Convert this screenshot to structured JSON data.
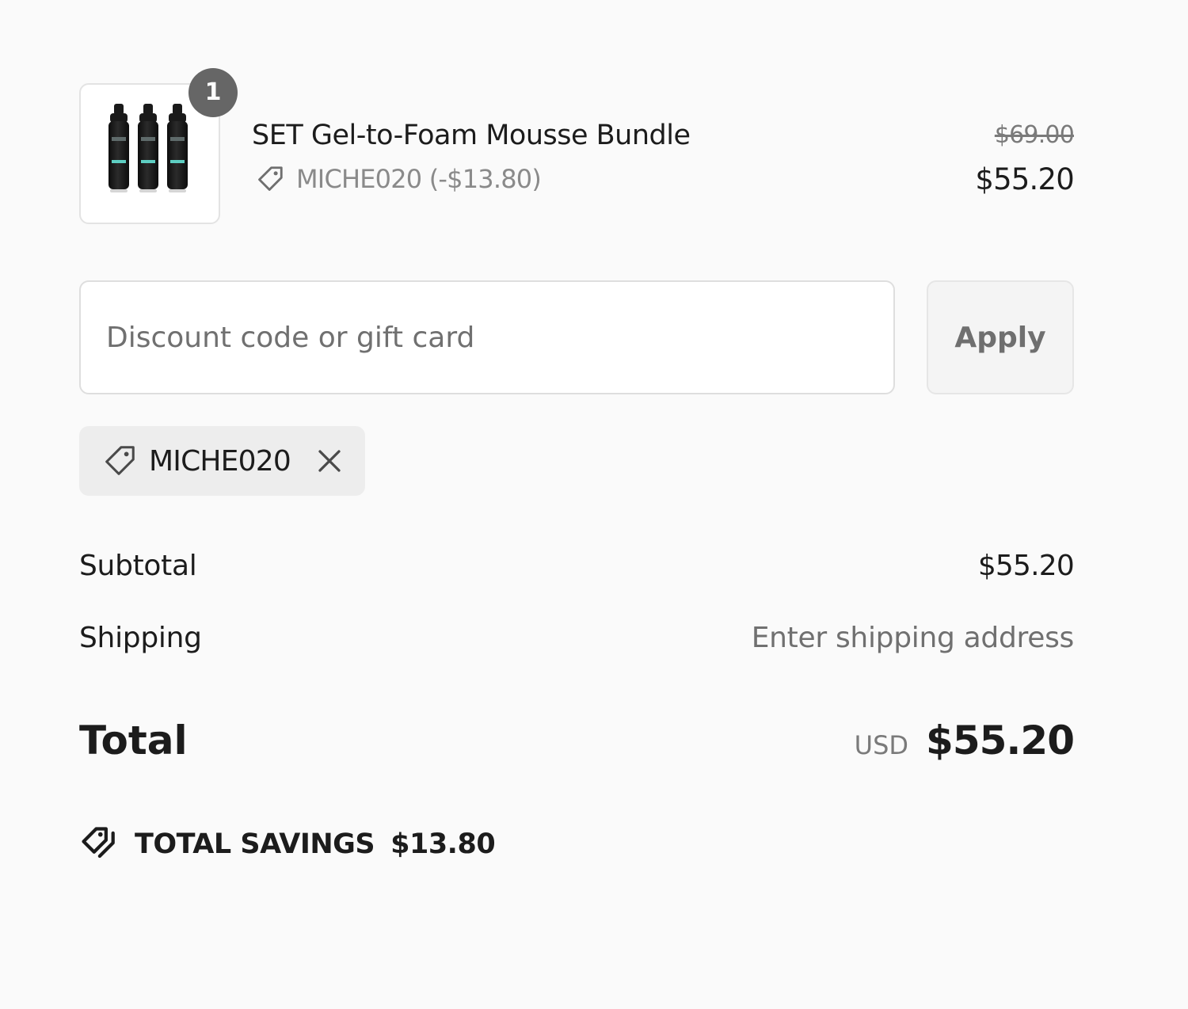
{
  "line_item": {
    "quantity": "1",
    "name": "SET Gel-to-Foam Mousse Bundle",
    "discount_line": "MICHE020 (-$13.80)",
    "original_price": "$69.00",
    "price": "$55.20",
    "image_icon": "product-bottles-icon"
  },
  "discount_form": {
    "placeholder": "Discount code or gift card",
    "value": "",
    "apply_label": "Apply"
  },
  "applied_code": {
    "code": "MICHE020",
    "icon": "tag-icon",
    "remove_icon": "close-icon"
  },
  "totals": {
    "subtotal_label": "Subtotal",
    "subtotal_value": "$55.20",
    "shipping_label": "Shipping",
    "shipping_value": "Enter shipping address",
    "total_label": "Total",
    "currency": "USD",
    "total_value": "$55.20"
  },
  "savings": {
    "label": "TOTAL SAVINGS",
    "value": "$13.80",
    "icon": "tags-icon"
  },
  "colors": {
    "background": "#fafafa",
    "text": "#1c1c1c",
    "muted_text": "#707070",
    "badge": "#666666",
    "chip_background": "#ededed"
  }
}
